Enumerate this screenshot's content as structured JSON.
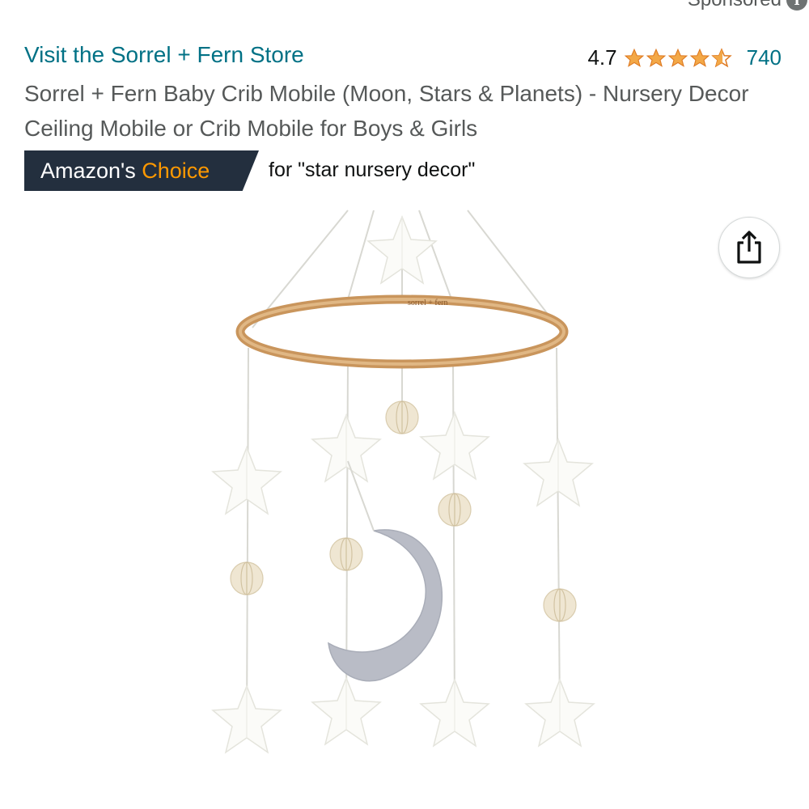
{
  "sponsored": {
    "label": "Sponsored",
    "icon": "info-icon"
  },
  "store": {
    "link_text": "Visit the Sorrel + Fern Store"
  },
  "rating": {
    "value": "4.7",
    "count": "740",
    "stars_out_of_5": 4.7,
    "star_color": "#f3a847"
  },
  "product": {
    "title": "Sorrel + Fern Baby Crib Mobile (Moon, Stars & Planets) - Nursery Decor Ceiling Mobile or Crib Mobile for Boys & Girls",
    "ring_engraving": "sorrel + fern"
  },
  "badge": {
    "prefix": "Amazon's",
    "highlight": "Choice",
    "for_text": "for \"star nursery decor\"",
    "bg_color": "#232f3e",
    "accent_color": "#ff9900"
  },
  "share": {
    "icon": "share-icon"
  },
  "colors": {
    "link": "#007185",
    "muted_text": "#565959"
  }
}
